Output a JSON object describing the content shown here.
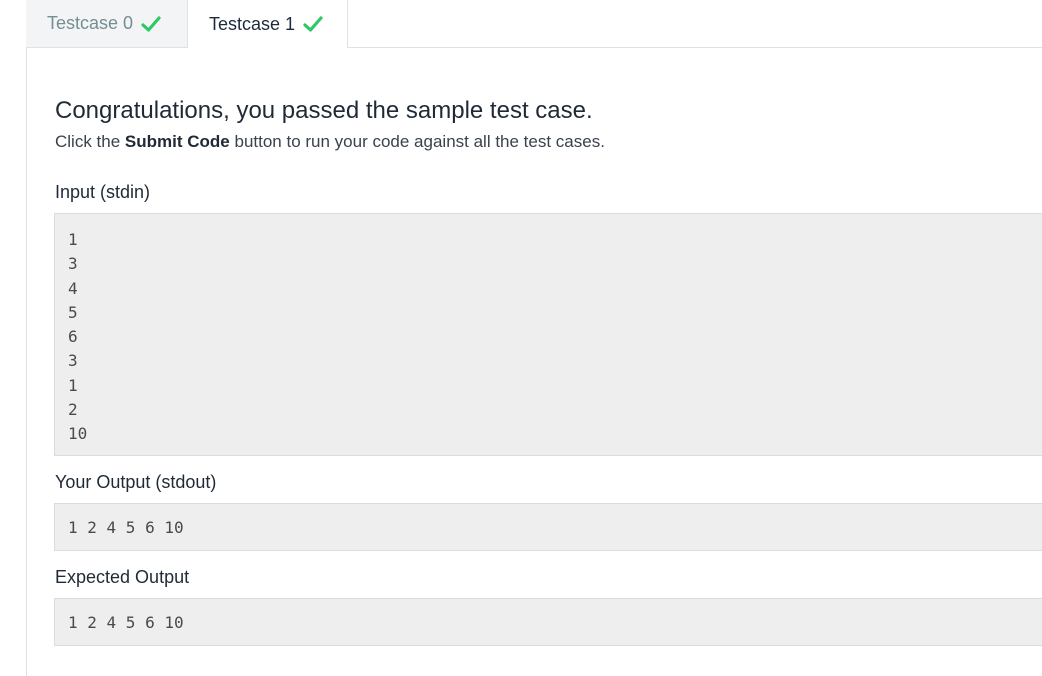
{
  "tabs": [
    {
      "label": "Testcase 0",
      "status_icon": "check-icon",
      "status_color": "#2ec866",
      "active": false
    },
    {
      "label": "Testcase 1",
      "status_icon": "check-icon",
      "status_color": "#2ec866",
      "active": true
    }
  ],
  "result": {
    "headline": "Congratulations, you passed the sample test case.",
    "instruction_prefix": "Click the ",
    "instruction_bold": "Submit Code",
    "instruction_suffix": " button to run your code against all the test cases."
  },
  "input": {
    "label": "Input (stdin)",
    "lines": [
      "1",
      "3",
      "4",
      "5",
      "6",
      "3",
      "1",
      "2",
      "10"
    ]
  },
  "your_output": {
    "label": "Your Output (stdout)",
    "lines": [
      "1 2 4 5 6 10"
    ]
  },
  "expected_output": {
    "label": "Expected Output",
    "lines": [
      "1 2 4 5 6 10"
    ]
  }
}
